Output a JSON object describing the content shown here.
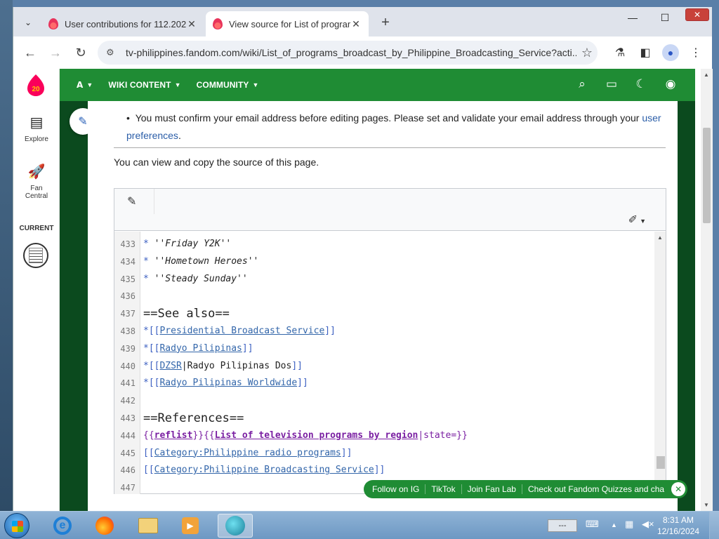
{
  "browser": {
    "tabs": [
      {
        "title": "User contributions for 112.202",
        "active": false
      },
      {
        "title": "View source for List of program",
        "active": true
      }
    ],
    "tab_list_icon": "chevron-down-icon",
    "new_tab_icon": "plus-icon",
    "window_controls": {
      "minimize": "—",
      "maximize": "☐",
      "close": "✕"
    },
    "url": "tv-philippines.fandom.com/wiki/List_of_programs_broadcast_by_Philippine_Broadcasting_Service?acti..."
  },
  "wiki_nav": {
    "menu_items": [
      {
        "label": "",
        "icon": "fandom-icon"
      },
      {
        "label": "WIKI CONTENT"
      },
      {
        "label": "COMMUNITY"
      }
    ],
    "accent_color": "#1f8c34"
  },
  "left_rail": {
    "logo_badge": "20",
    "explore_label": "Explore",
    "fan_central_label_1": "Fan",
    "fan_central_label_2": "Central",
    "current_label": "CURRENT"
  },
  "notice": {
    "text": "You must confirm your email address before editing pages. Please set and validate your email address through your ",
    "link": "user preferences",
    "end": "."
  },
  "view_copy_text": "You can view and copy the source of this page.",
  "code_lines": [
    {
      "num": "433",
      "parts": [
        {
          "t": "* ",
          "c": "blue"
        },
        {
          "t": "''Friday Y2K''",
          "c": "italic"
        }
      ]
    },
    {
      "num": "434",
      "parts": [
        {
          "t": "* ",
          "c": "blue"
        },
        {
          "t": "''Hometown Heroes''",
          "c": "italic"
        }
      ]
    },
    {
      "num": "435",
      "parts": [
        {
          "t": "* ",
          "c": "blue"
        },
        {
          "t": "''Steady Sunday''",
          "c": "italic"
        }
      ]
    },
    {
      "num": "436",
      "parts": []
    },
    {
      "num": "437",
      "parts": [
        {
          "t": "==",
          "c": "blue heading"
        },
        {
          "t": "See also",
          "c": "heading"
        },
        {
          "t": "==",
          "c": "blue heading"
        }
      ]
    },
    {
      "num": "438",
      "parts": [
        {
          "t": "*",
          "c": "blue"
        },
        {
          "t": "[[",
          "c": "blue"
        },
        {
          "t": "Presidential Broadcast Service",
          "c": "lnk"
        },
        {
          "t": "]]",
          "c": "blue"
        }
      ]
    },
    {
      "num": "439",
      "parts": [
        {
          "t": "*",
          "c": "blue"
        },
        {
          "t": "[[",
          "c": "blue"
        },
        {
          "t": "Radyo Pilipinas",
          "c": "lnk"
        },
        {
          "t": "]]",
          "c": "blue"
        }
      ]
    },
    {
      "num": "440",
      "parts": [
        {
          "t": "*",
          "c": "blue"
        },
        {
          "t": "[[",
          "c": "blue"
        },
        {
          "t": "DZSR",
          "c": "lnk"
        },
        {
          "t": "|Radyo Pilipinas Dos",
          "c": ""
        },
        {
          "t": "]]",
          "c": "blue"
        }
      ]
    },
    {
      "num": "441",
      "parts": [
        {
          "t": "*",
          "c": "blue"
        },
        {
          "t": "[[",
          "c": "blue"
        },
        {
          "t": "Radyo Pilipinas Worldwide",
          "c": "lnk"
        },
        {
          "t": "]]",
          "c": "blue"
        }
      ]
    },
    {
      "num": "442",
      "parts": []
    },
    {
      "num": "443",
      "parts": [
        {
          "t": "==",
          "c": "blue heading"
        },
        {
          "t": "References",
          "c": "heading"
        },
        {
          "t": "==",
          "c": "blue heading"
        }
      ]
    },
    {
      "num": "444",
      "parts": [
        {
          "t": "{{",
          "c": "tmpl"
        },
        {
          "t": "reflist",
          "c": "tmpl-u"
        },
        {
          "t": "}}{{",
          "c": "tmpl"
        },
        {
          "t": "List of television programs by region",
          "c": "tmpl-u"
        },
        {
          "t": "|state=}}",
          "c": "tmpl"
        }
      ]
    },
    {
      "num": "445",
      "parts": [
        {
          "t": "[[",
          "c": "blue"
        },
        {
          "t": "Category:Philippine radio programs",
          "c": "lnk"
        },
        {
          "t": "]]",
          "c": "blue"
        }
      ]
    },
    {
      "num": "446",
      "parts": [
        {
          "t": "[[",
          "c": "blue"
        },
        {
          "t": "Category:Philippine Broadcasting Service",
          "c": "lnk"
        },
        {
          "t": "]]",
          "c": "blue"
        }
      ]
    },
    {
      "num": "447",
      "parts": []
    }
  ],
  "social_bar": {
    "items": [
      "Follow on IG",
      "TikTok",
      "Join Fan Lab",
      "Check out Fandom Quizzes and cha"
    ]
  },
  "taskbar": {
    "language": "---",
    "time": "8:31 AM",
    "date": "12/16/2024"
  }
}
